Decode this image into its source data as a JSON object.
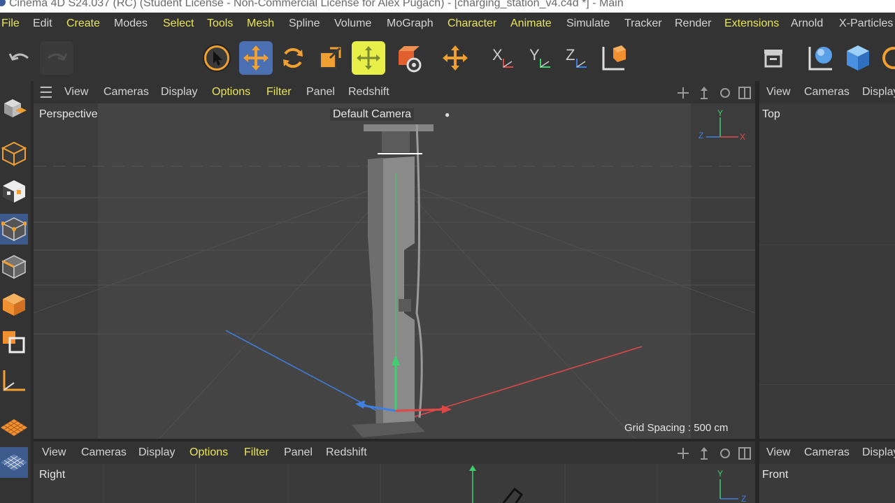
{
  "window": {
    "title": "Cinema 4D S24.037 (RC) (Student License - Non-Commercial License for Alex Pugach) - [charging_station_v4.c4d *] - Main"
  },
  "menu": [
    "File",
    "Edit",
    "Create",
    "Modes",
    "Select",
    "Tools",
    "Mesh",
    "Spline",
    "Volume",
    "MoGraph",
    "Character",
    "Animate",
    "Simulate",
    "Tracker",
    "Render",
    "Extensions",
    "Arnold",
    "X-Particles"
  ],
  "viewport_menu": [
    "View",
    "Cameras",
    "Display",
    "Options",
    "Filter",
    "Panel",
    "Redshift"
  ],
  "viewport_menu_short": [
    "View",
    "Cameras",
    "Display"
  ],
  "viewports": {
    "perspective": {
      "name": "Perspective",
      "camera": "Default Camera",
      "grid_spacing": "Grid Spacing : 500 cm"
    },
    "top": {
      "name": "Top"
    },
    "right": {
      "name": "Right"
    },
    "front": {
      "name": "Front"
    }
  },
  "icons": {
    "toolbar": [
      "undo-icon",
      "redo-icon",
      "live-selection-icon",
      "move-icon",
      "rotate-icon",
      "scale-icon",
      "transform-icon",
      "object-axis-icon",
      "move-tool-icon",
      "x-axis-lock-icon",
      "y-axis-lock-icon",
      "z-axis-lock-icon",
      "coordinate-system-icon",
      "render-region-icon",
      "render-view-icon",
      "cube-object-icon"
    ],
    "left": [
      "make-editable-icon",
      "cube-mode-icon",
      "checker-icon",
      "points-mode-icon",
      "edges-mode-icon",
      "polygons-mode-icon",
      "uv-mode-icon",
      "axis-icon",
      "grid-icon",
      "snap-icon"
    ]
  },
  "colors": {
    "accent": "#e9e55a",
    "selected": "#4a6fb3",
    "viewport_bg": "#3e3e3e",
    "axis_x": "#e04848",
    "axis_y": "#3fcf6f",
    "axis_z": "#3f7fe0"
  }
}
